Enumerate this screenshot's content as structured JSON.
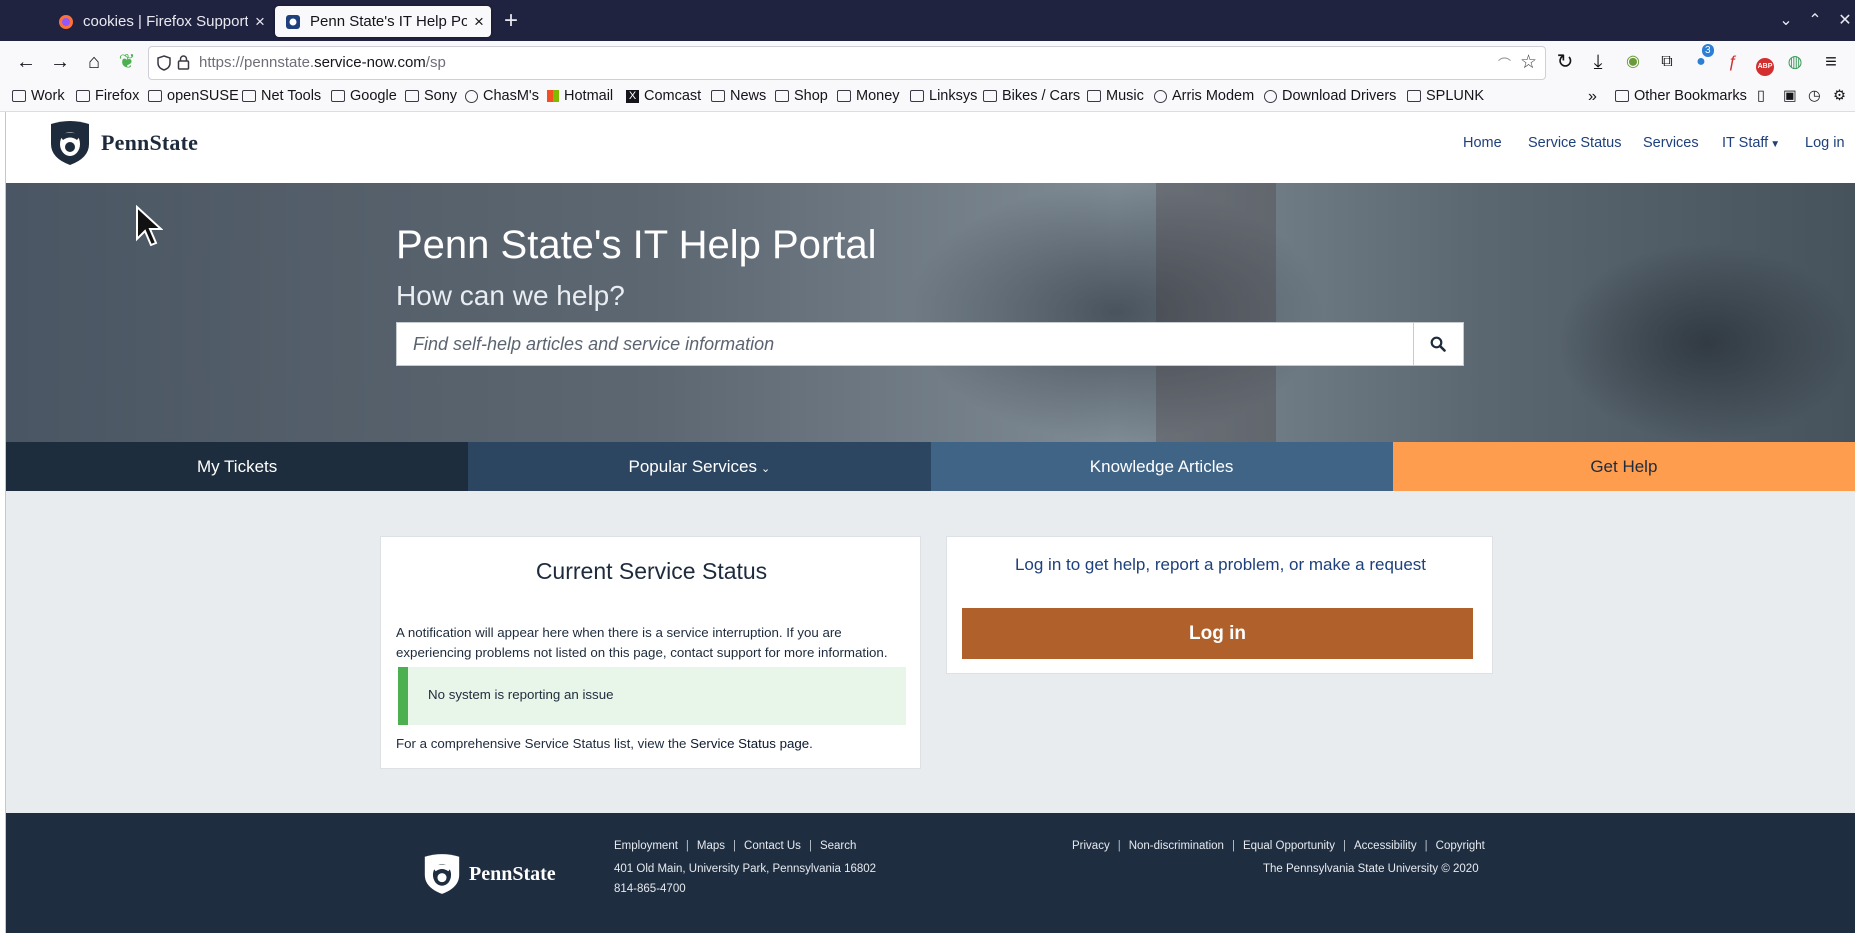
{
  "browser": {
    "tabs": [
      {
        "title": "cookies | Firefox Support F",
        "active": false
      },
      {
        "title": "Penn State's IT Help Portal",
        "active": true
      }
    ],
    "url_host": "https://pennstate.",
    "url_domain": "service-now.com",
    "url_path": "/sp",
    "extension_badge": "3",
    "bookmarks": [
      {
        "label": "Work",
        "icon": "folder-icon"
      },
      {
        "label": "Firefox",
        "icon": "folder-icon"
      },
      {
        "label": "openSUSE",
        "icon": "folder-icon"
      },
      {
        "label": "Net Tools",
        "icon": "folder-icon"
      },
      {
        "label": "Google",
        "icon": "folder-icon"
      },
      {
        "label": "Sony",
        "icon": "folder-icon"
      },
      {
        "label": "ChasM's",
        "icon": "globe-icon"
      },
      {
        "label": "Hotmail",
        "icon": "microsoft-icon"
      },
      {
        "label": "Comcast",
        "icon": "x-icon"
      },
      {
        "label": "News",
        "icon": "folder-icon"
      },
      {
        "label": "Shop",
        "icon": "folder-icon"
      },
      {
        "label": "Money",
        "icon": "folder-icon"
      },
      {
        "label": "Linksys",
        "icon": "folder-icon"
      },
      {
        "label": "Bikes / Cars",
        "icon": "folder-icon"
      },
      {
        "label": "Music",
        "icon": "folder-icon"
      },
      {
        "label": "Arris Modem",
        "icon": "globe-icon"
      },
      {
        "label": "Download Drivers",
        "icon": "globe-icon"
      },
      {
        "label": "SPLUNK",
        "icon": "folder-icon"
      }
    ],
    "other_bookmarks": "Other Bookmarks"
  },
  "header": {
    "logo_text": "PennState",
    "nav": [
      "Home",
      "Service Status",
      "Services",
      "IT Staff",
      "Log in"
    ]
  },
  "hero": {
    "title": "Penn State's IT Help Portal",
    "subtitle": "How can we help?",
    "search_placeholder": "Find self-help articles and service information"
  },
  "tiles": [
    {
      "label": "My Tickets",
      "bg": "#1e2d3d",
      "fg": "#ffffff"
    },
    {
      "label": "Popular Services",
      "bg": "#2c4560",
      "fg": "#ffffff"
    },
    {
      "label": "Knowledge Articles",
      "bg": "#3f6486",
      "fg": "#ffffff"
    },
    {
      "label": "Get Help",
      "bg": "#ff9d4f",
      "fg": "#1e2b3c"
    }
  ],
  "status_card": {
    "title": "Current Service Status",
    "note": "A notification will appear here when there is a service interruption. If you are experiencing problems not listed on this page, contact support for more information.",
    "ok_message": "No system is reporting an issue",
    "more_prefix": "For a comprehensive Service Status list, view the ",
    "more_link": "Service Status page",
    "more_suffix": "."
  },
  "login_card": {
    "message": "Log in to get help, report a problem, or make a request",
    "button": "Log in"
  },
  "footer": {
    "logo_text": "PennState",
    "links_left": [
      "Employment",
      "Maps",
      "Contact Us",
      "Search"
    ],
    "address": "401 Old Main, University Park, Pennsylvania 16802",
    "phone": "814-865-4700",
    "links_right": [
      "Privacy",
      "Non-discrimination",
      "Equal Opportunity",
      "Accessibility",
      "Copyright"
    ],
    "copyright": "The Pennsylvania State University © 2020"
  },
  "colors": {
    "accent_orange": "#ff9d4f",
    "login_button": "#b0602b",
    "footer_bg": "#1e2d40",
    "link_blue": "#1e407c"
  }
}
